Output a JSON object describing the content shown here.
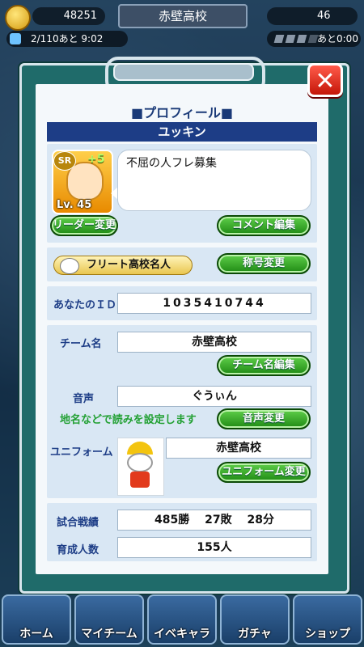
{
  "status": {
    "coins": "48251",
    "team_name": "赤壁高校",
    "gems": "46",
    "stamina": "2/110あと 9:02",
    "energy_timer_prefix": "あと",
    "energy_timer": "0:00"
  },
  "dialog": {
    "title": "■プロフィール■",
    "close_label": "✕",
    "player_name": "ユッキン",
    "avatar": {
      "rank": "SR",
      "bonus": "+5",
      "level": "Lv. 45"
    },
    "comment": "不屈の人フレ募集",
    "leader_change_button": "リーダー変更",
    "comment_edit_button": "コメント編集",
    "title_badge": "フリート高校名人",
    "title_change_button": "称号変更",
    "id_label": "あなたのＩＤ",
    "id_value": "1035410744",
    "team_label": "チーム名",
    "team_value": "赤壁高校",
    "team_edit_button": "チーム名編集",
    "voice_label": "音声",
    "voice_value": "ぐうぃん",
    "voice_hint": "地名などで読みを設定します",
    "voice_change_button": "音声変更",
    "uniform_label": "ユニフォーム",
    "uniform_value": "赤壁高校",
    "uniform_change_button": "ユニフォーム変更",
    "record_label": "試合戦績",
    "record_value": "485勝　 27敗　 28分",
    "trained_label": "育成人数",
    "trained_value": "155人"
  },
  "nav": [
    {
      "label": "ホーム",
      "icon": "home-icon"
    },
    {
      "label": "マイチーム",
      "icon": "team-icon"
    },
    {
      "label": "イベキャラ",
      "icon": "event-character-icon"
    },
    {
      "label": "ガチャ",
      "icon": "gacha-icon"
    },
    {
      "label": "ショップ",
      "icon": "shop-icon"
    }
  ]
}
